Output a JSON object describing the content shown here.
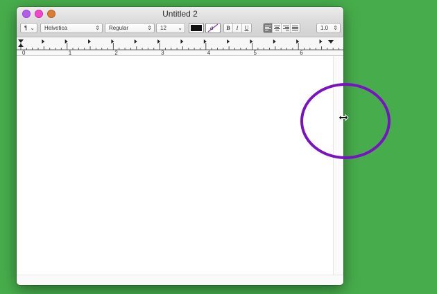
{
  "window": {
    "title": "Untitled 2"
  },
  "toolbar": {
    "paragraph_style": "¶",
    "font_family": "Helvetica",
    "typeface": "Regular",
    "font_size": "12",
    "bold": "B",
    "italic": "I",
    "underline": "U",
    "line_spacing": "1.0",
    "text_color": "#111111",
    "highlight_label": "a"
  },
  "ruler": {
    "numbers": [
      "0",
      "1",
      "2",
      "3",
      "4",
      "5",
      "6"
    ]
  },
  "annotation": {
    "color": "#7a12c4"
  }
}
